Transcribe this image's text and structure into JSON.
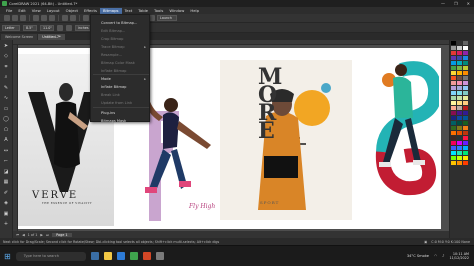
{
  "window": {
    "title": "CorelDRAW 2021 (64-Bit) - Untitled-7*",
    "controls": [
      "—",
      "❐",
      "✕"
    ]
  },
  "menubar": {
    "items": [
      "File",
      "Edit",
      "View",
      "Layout",
      "Object",
      "Effects",
      "Bitmaps",
      "Text",
      "Table",
      "Tools",
      "Window",
      "Help"
    ],
    "active": "Bitmaps"
  },
  "std_toolbar": {
    "zoom": "20%",
    "snap_label": "Snap To",
    "launch_label": "Launch"
  },
  "property_bar": {
    "label": "Letter",
    "x": "8.5\"",
    "y": "11.0\"",
    "units": "inches",
    "nudge": "0.1\"",
    "dup_x": "0.25\"",
    "dup_y": "0.25\""
  },
  "tabs": [
    {
      "label": "Welcome Screen"
    },
    {
      "label": "Untitled-7*"
    }
  ],
  "dropdown": {
    "items": [
      {
        "label": "Convert to Bitmap...",
        "dim": false
      },
      {
        "label": "Edit Bitmap...",
        "dim": true
      },
      {
        "label": "Crop Bitmap",
        "dim": true
      },
      {
        "label": "Trace Bitmap",
        "dim": true,
        "submenu": true
      },
      {
        "label": "Resample...",
        "dim": true
      },
      {
        "label": "Bitmap Color Mask",
        "dim": true
      },
      {
        "label": "Inflate Bitmap",
        "dim": true
      },
      {
        "label": "Mode",
        "dim": false,
        "submenu": true
      },
      {
        "label": "Inflate Bitmap",
        "dim": false
      },
      {
        "label": "Break Link",
        "dim": true
      },
      {
        "label": "Update from Link",
        "dim": true
      },
      {
        "label": "Plug-ins",
        "dim": false
      },
      {
        "label": "Bitmaps Mask",
        "dim": false
      }
    ]
  },
  "artboards": {
    "verve": {
      "title": "VERVE",
      "subtitle": "THE ESSENCE OF VIVACITY"
    },
    "second": {
      "script": "Fly High"
    },
    "third": {
      "letters": "MORE",
      "sub": "SPORT"
    }
  },
  "page_nav": {
    "label": "Page 1",
    "count": "1 of 1"
  },
  "status": {
    "hint": "Next click for Drag/Scale; Second click for Rotate/Skew; Dbl-clicking tool selects all objects; Shift+click multi-selects; Alt+click digs",
    "right": "C:0 M:0 Y:0 K:100 None"
  },
  "taskbar": {
    "search_placeholder": "Type here to search",
    "weather": "34°C Smoke",
    "time": "10:11 AM",
    "date": "11/12/2022"
  },
  "palette_colors": [
    "#000000",
    "#333333",
    "#666666",
    "#999999",
    "#cccccc",
    "#ffffff",
    "#e53935",
    "#d81b60",
    "#8e24aa",
    "#5e35b1",
    "#3949ab",
    "#1e88e5",
    "#039be5",
    "#00acc1",
    "#00897b",
    "#43a047",
    "#7cb342",
    "#c0ca33",
    "#fdd835",
    "#ffb300",
    "#fb8c00",
    "#f4511e",
    "#6d4c41",
    "#757575",
    "#ef9a9a",
    "#f48fb1",
    "#ce93d8",
    "#b39ddb",
    "#9fa8da",
    "#90caf9",
    "#81d4fa",
    "#80deea",
    "#80cbc4",
    "#a5d6a7",
    "#c5e1a5",
    "#e6ee9c",
    "#fff59d",
    "#ffe082",
    "#ffcc80",
    "#ffab91",
    "#bcaaa4",
    "#b71c1c",
    "#880e4f",
    "#4a148c",
    "#311b92",
    "#1a237e",
    "#0d47a1",
    "#01579b",
    "#006064",
    "#004d40",
    "#1b5e20",
    "#33691e",
    "#827717",
    "#f57f17",
    "#ff6f00",
    "#e65100",
    "#bf360c",
    "#3e2723",
    "#263238",
    "#ff1744",
    "#f50057",
    "#d500f9",
    "#651fff",
    "#3d5afe",
    "#2979ff",
    "#00b0ff",
    "#00e5ff",
    "#1de9b6",
    "#00e676",
    "#76ff03",
    "#c6ff00",
    "#ffea00",
    "#ffc400",
    "#ff9100",
    "#ff3d00"
  ]
}
